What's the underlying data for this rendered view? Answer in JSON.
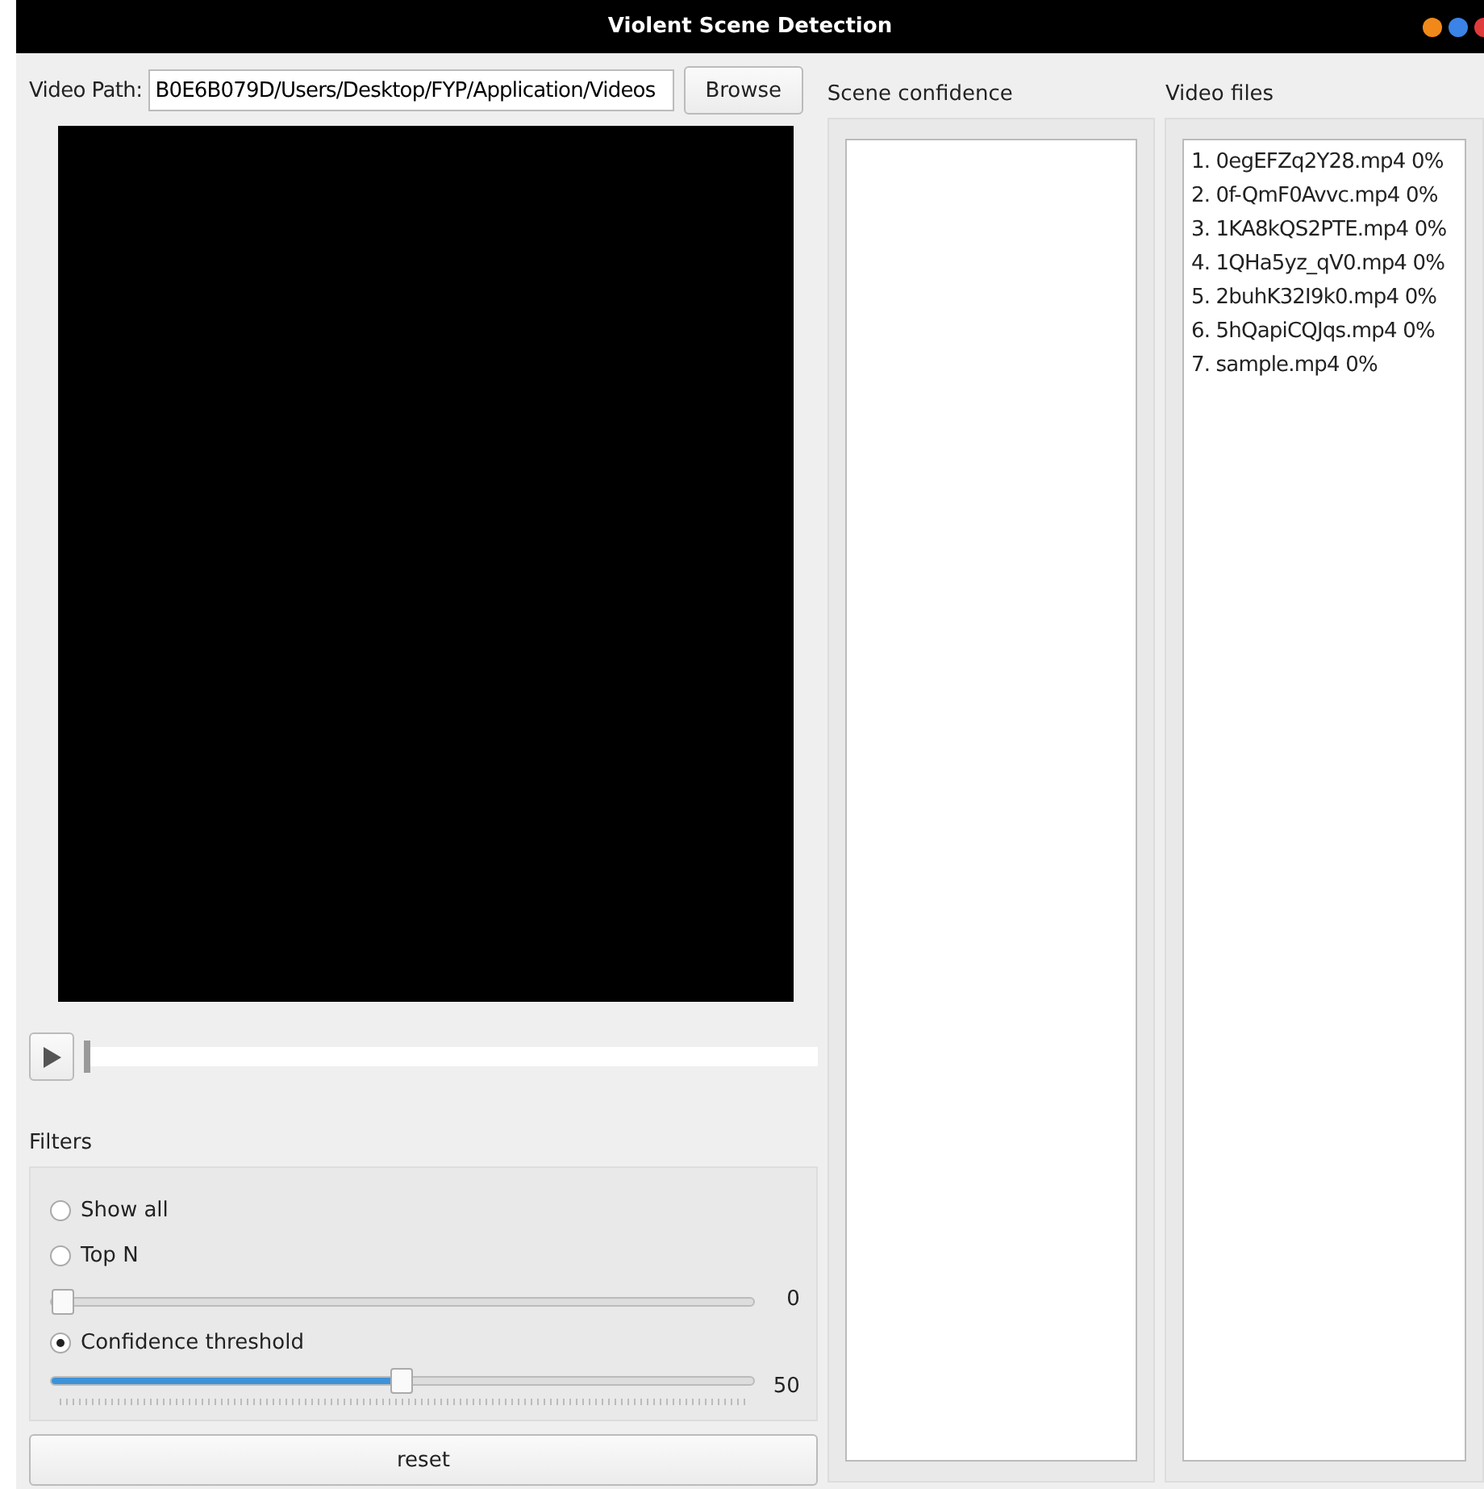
{
  "window": {
    "title": "Violent Scene Detection",
    "controls": [
      {
        "color": "#f0891a"
      },
      {
        "color": "#3b83e6"
      },
      {
        "color": "#e03a3a"
      }
    ]
  },
  "video_path": {
    "label": "Video Path:",
    "value": "B0E6B079D/Users/Desktop/FYP/Application/Videos",
    "button": "Browse"
  },
  "player": {
    "kind": "picture",
    "seek": {
      "level": 0
    }
  },
  "filters": {
    "title": "Filters",
    "options": [
      {
        "kind": "radio",
        "label": "Show all",
        "selected": false
      },
      {
        "kind": "radio",
        "label": "Top N",
        "selected": false
      },
      {
        "kind": "slider",
        "level": 0,
        "reading": "0",
        "ticks": false
      },
      {
        "kind": "radio",
        "label": "Confidence threshold",
        "selected": true
      },
      {
        "kind": "slider",
        "level": 0.5,
        "reading": "50",
        "ticks": true
      }
    ],
    "reset": "reset"
  },
  "scene_confidence": {
    "title": "Scene confidence"
  },
  "video_files": {
    "title": "Video files",
    "items": [
      "1. 0egEFZq2Y28.mp4 0%",
      "2. 0f-QmF0Avvc.mp4 0%",
      "3. 1KA8kQS2PTE.mp4 0%",
      "4. 1QHa5yz_qV0.mp4 0%",
      "5. 2buhK32I9k0.mp4 0%",
      "6. 5hQapiCQJqs.mp4 0%",
      "7. sample.mp4 0%"
    ]
  }
}
